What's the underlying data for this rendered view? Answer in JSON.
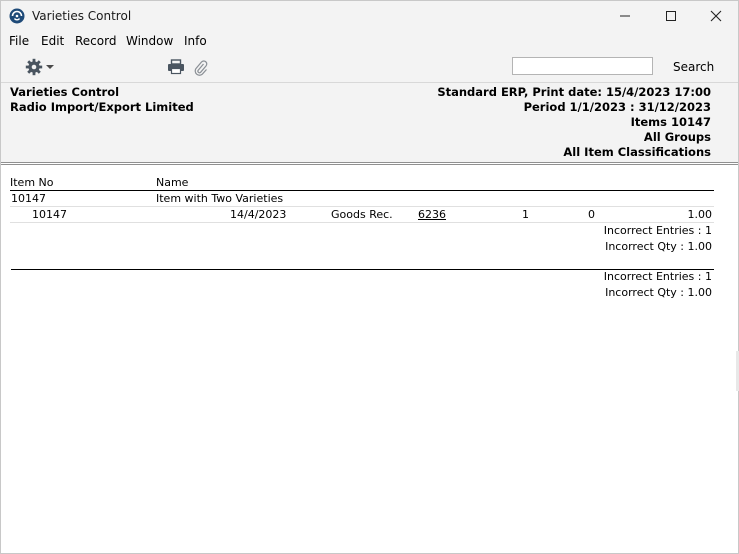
{
  "window": {
    "title": "Varieties Control"
  },
  "menu": [
    "File",
    "Edit",
    "Record",
    "Window",
    "Info"
  ],
  "toolbar": {
    "search_placeholder": "",
    "search_label": "Search"
  },
  "report_header": {
    "title": "Varieties Control",
    "company": "Radio Import/Export Limited",
    "system_line": "Standard ERP, Print date: 15/4/2023 17:00",
    "period_line": "Period  1/1/2023 : 31/12/2023",
    "items_line": "Items  10147",
    "groups_line": "All Groups",
    "classifications_line": "All Item Classifications"
  },
  "columns": {
    "item_no": "Item No",
    "name": "Name"
  },
  "item": {
    "item_no": "10147",
    "name": "Item with Two Varieties",
    "detail": {
      "item_no": "10147",
      "date": "14/4/2023",
      "type": "Goods Rec.",
      "number": "6236",
      "col1": "1",
      "col2": "0",
      "qty": "1.00"
    },
    "incorrect_entries": "Incorrect Entries : 1",
    "incorrect_qty": "Incorrect Qty : 1.00"
  },
  "totals": {
    "incorrect_entries": "Incorrect Entries : 1",
    "incorrect_qty": "Incorrect Qty : 1.00"
  }
}
